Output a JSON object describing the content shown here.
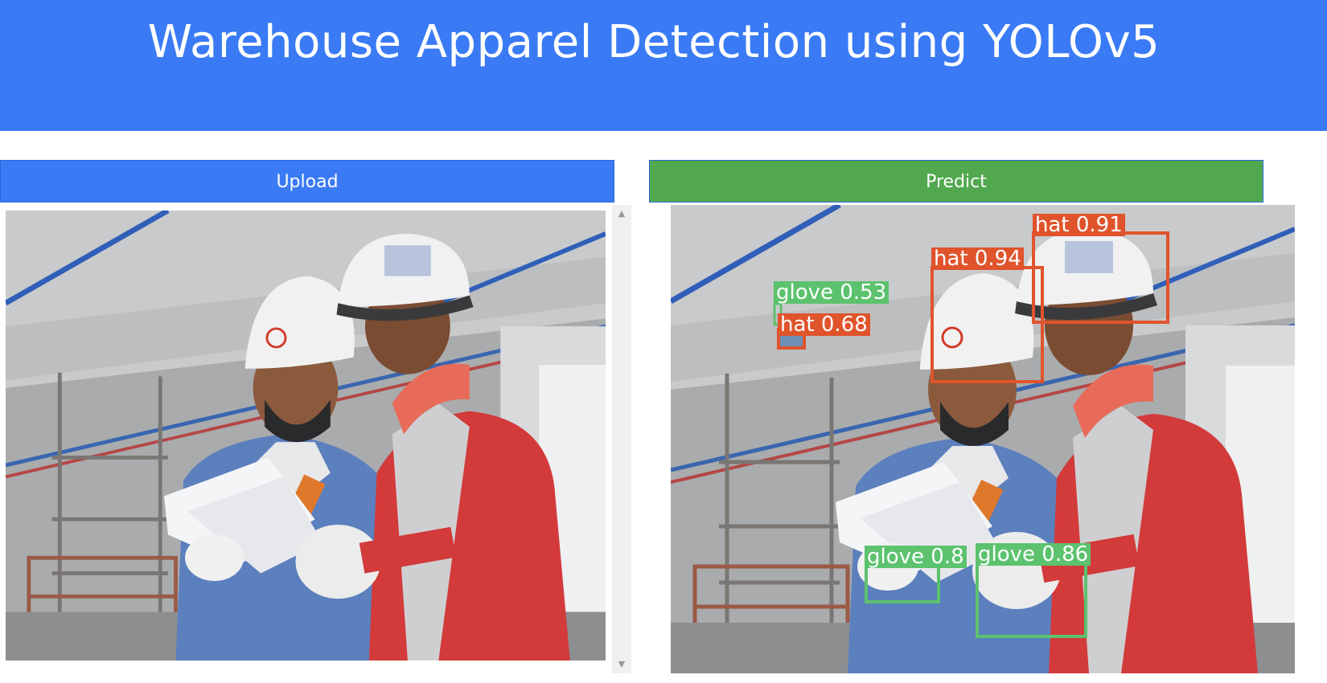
{
  "header": {
    "title": "Warehouse Apparel Detection using YOLOv5"
  },
  "buttons": {
    "upload": "Upload",
    "predict": "Predict"
  },
  "colors": {
    "header_bg": "#3a7bf5",
    "upload_bg": "#3a7bf5",
    "predict_bg": "#52a84e",
    "hat_class": "#e0542c",
    "glove_class": "#5cc26e"
  },
  "scrollbar": {
    "up_icon": "▲",
    "down_icon": "▼"
  },
  "detections": [
    {
      "label": "hat 0.91",
      "cls": "hat"
    },
    {
      "label": "hat 0.94",
      "cls": "hat"
    },
    {
      "label": "glove 0.53",
      "cls": "glove"
    },
    {
      "label": "hat 0.68",
      "cls": "hat"
    },
    {
      "label": "glove 0.8",
      "cls": "glove"
    },
    {
      "label": "glove 0.86",
      "cls": "glove"
    }
  ]
}
